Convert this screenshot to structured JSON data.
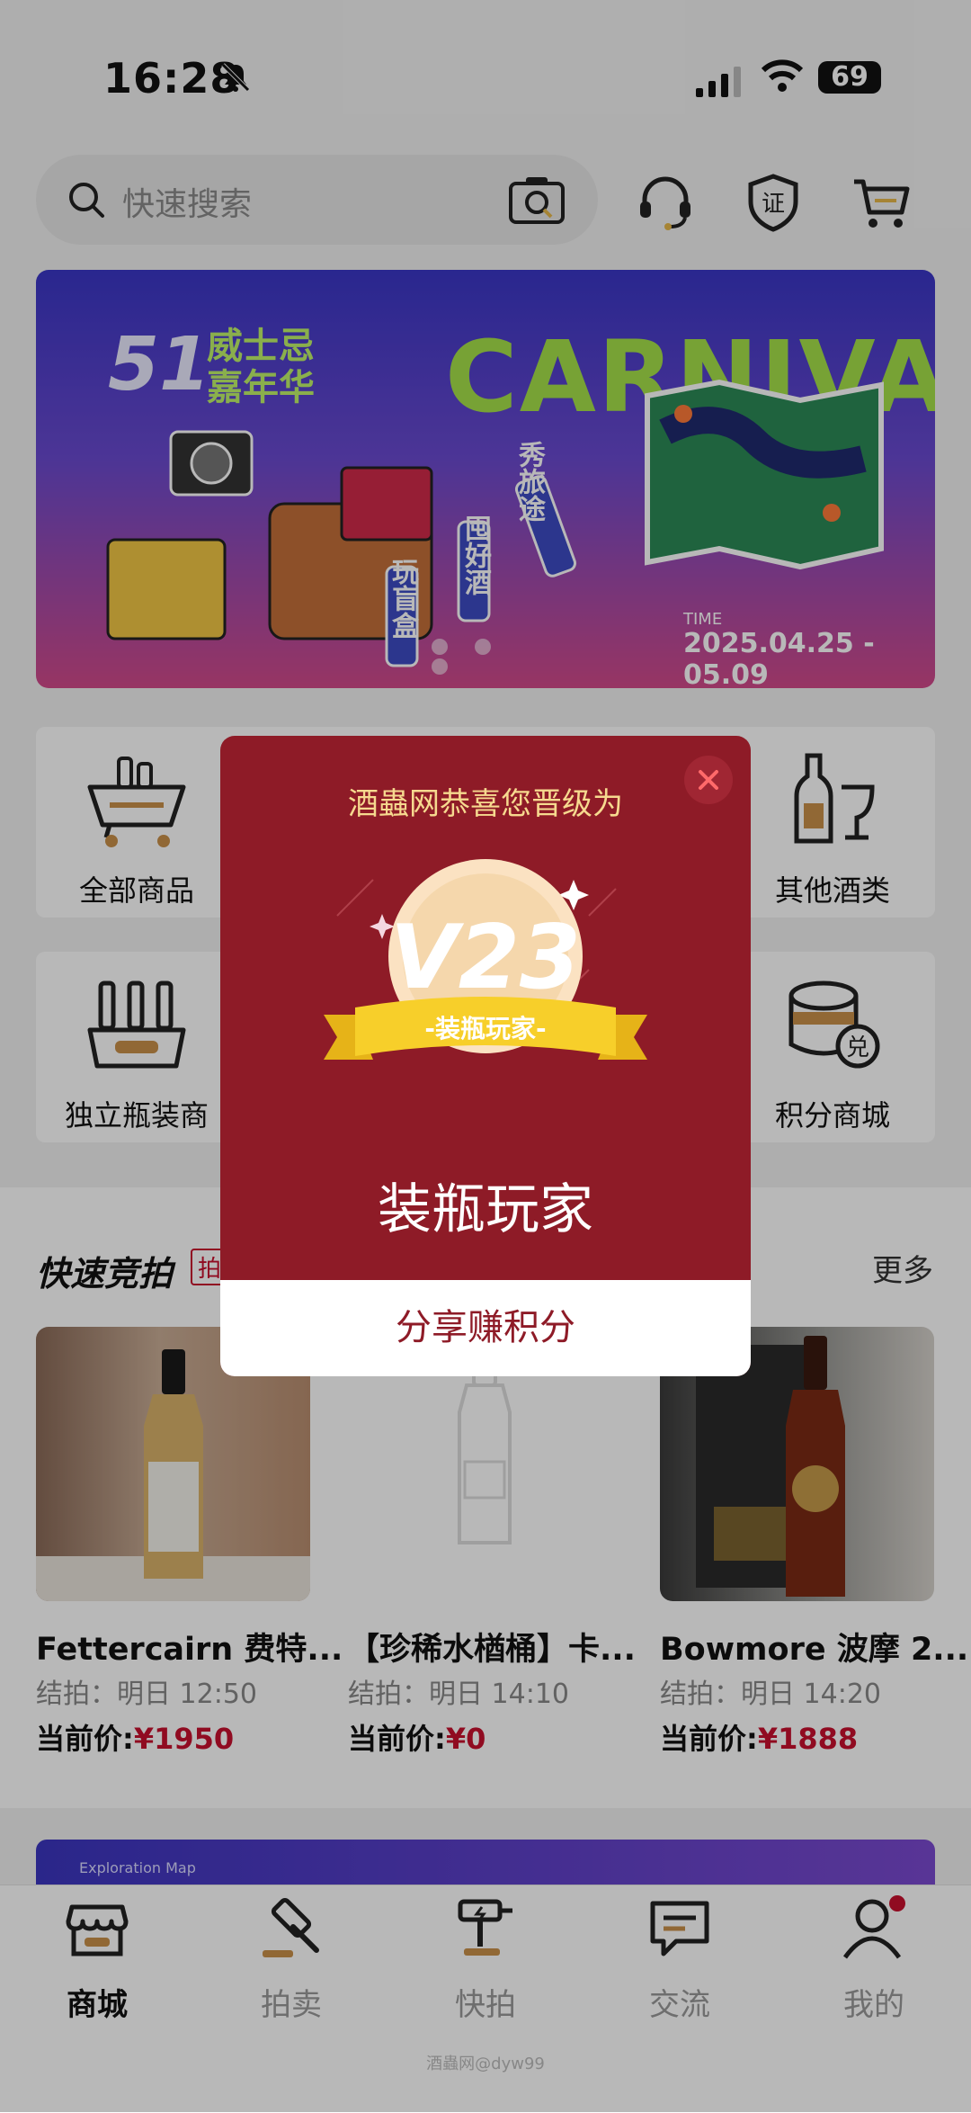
{
  "status_bar": {
    "time": "16:28",
    "battery": "69"
  },
  "search": {
    "placeholder": "快速搜索"
  },
  "banner": {
    "badge": "51",
    "event_line1": "威士忌",
    "event_line2": "嘉年华",
    "headline": "CARNIVAL",
    "time_label": "TIME",
    "dates": "2025.04.25 - 05.09",
    "tags": [
      "玩盲盒",
      "囤好酒",
      "秀旅途"
    ]
  },
  "categories": {
    "row1_left": "全部商品",
    "row1_right": "其他酒类",
    "row2_left": "独立瓶装商",
    "row2_right": "积分商城",
    "coin_char": "兑"
  },
  "auction": {
    "title": "快速竞拍",
    "tag": "拍",
    "more": "更多",
    "products": [
      {
        "name": "Fettercairn 费特...",
        "end": "结拍：明日 12:50",
        "price_label": "当前价:",
        "price": "¥1950"
      },
      {
        "name": "【珍稀水楢桶】卡...",
        "end": "结拍：明日 14:10",
        "price_label": "当前价:",
        "price": "¥0"
      },
      {
        "name": "Bowmore 波摩 2...",
        "end": "结拍：明日 14:20",
        "price_label": "当前价:",
        "price": "¥1888"
      }
    ]
  },
  "banner2": {
    "text": "Exploration Map"
  },
  "tabs": [
    {
      "label": "商城"
    },
    {
      "label": "拍卖"
    },
    {
      "label": "快拍"
    },
    {
      "label": "交流"
    },
    {
      "label": "我的"
    }
  ],
  "watermark": "酒蟲网@dyw99",
  "modal": {
    "heading": "酒蟲网恭喜您晋级为",
    "level": "V23",
    "ribbon": "-装瓶玩家-",
    "title": "装瓶玩家",
    "share_button": "分享赚积分"
  },
  "colors": {
    "accent": "#c8102e",
    "modal_bg": "#8e1b27",
    "gold": "#f6d98f"
  }
}
